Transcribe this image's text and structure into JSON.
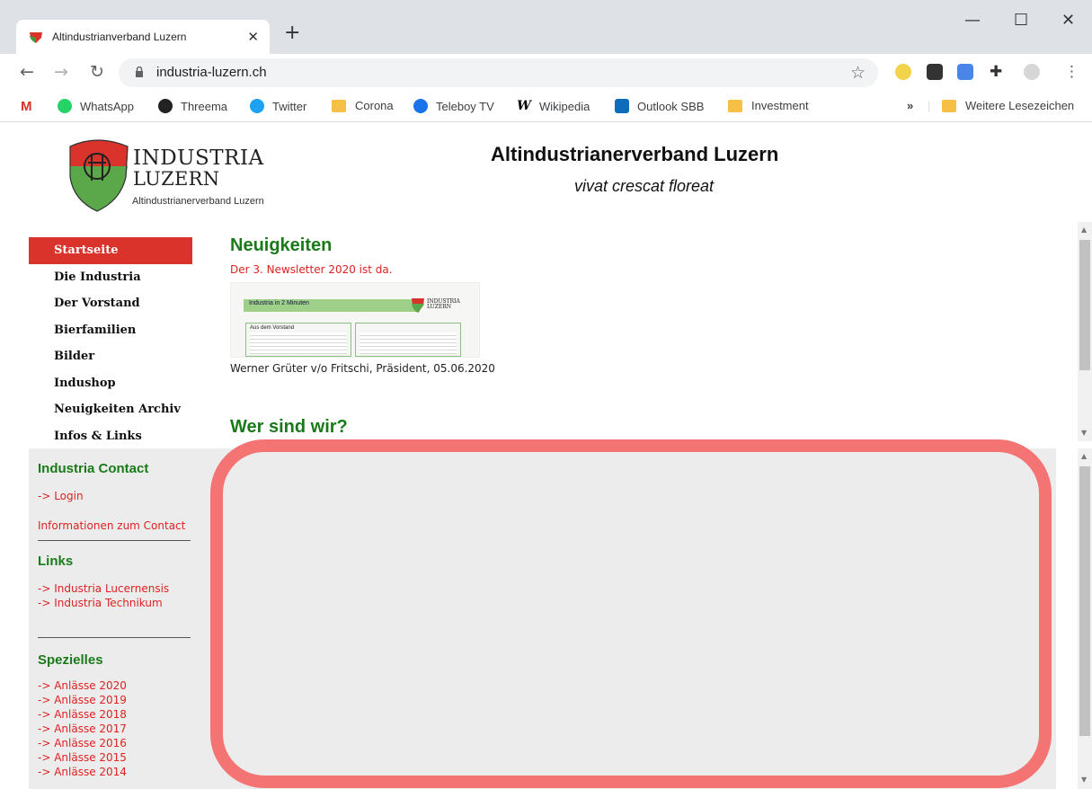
{
  "browser": {
    "tab_title": "Altindustrianverband Luzern",
    "url": "industria-luzern.ch",
    "new_tab_symbol": "+",
    "close_tab_symbol": "✕",
    "window_controls": {
      "minimize": "—",
      "maximize": "☐",
      "close": "✕"
    },
    "more_bookmarks": "»",
    "bookmarks": [
      {
        "label": "WhatsApp",
        "icon": "whatsapp-icon",
        "color": "#25d366"
      },
      {
        "label": "Threema",
        "icon": "threema-icon",
        "color": "#222222"
      },
      {
        "label": "Twitter",
        "icon": "twitter-icon",
        "color": "#1da1f2"
      },
      {
        "label": "Corona",
        "icon": "folder-icon",
        "color": "#f6c046"
      },
      {
        "label": "Teleboy TV",
        "icon": "teleboy-icon",
        "color": "#1a73e8"
      },
      {
        "label": "Wikipedia",
        "icon": "wikipedia-icon",
        "color": "#000000"
      },
      {
        "label": "Outlook SBB",
        "icon": "outlook-icon",
        "color": "#0f6cbd"
      },
      {
        "label": "Investment",
        "icon": "folder-icon",
        "color": "#f6c046"
      }
    ],
    "other_bookmarks": "Weitere Lesezeichen",
    "gmail_icon_letter": "M"
  },
  "site": {
    "logo_line1": "INDUSTRIA",
    "logo_line2": "LUZERN",
    "logo_sub": "Altindustrianerverband Luzern",
    "title": "Altindustrianerverband Luzern",
    "motto": "vivat crescat floreat",
    "colors": {
      "red": "#d9332b",
      "green": "#1a7a1a",
      "link": "#dd2222",
      "highlight": "#f47474"
    }
  },
  "nav": {
    "items": [
      {
        "label": "Startseite",
        "active": true
      },
      {
        "label": "Die Industria"
      },
      {
        "label": "Der Vorstand"
      },
      {
        "label": "Bierfamilien"
      },
      {
        "label": "Bilder"
      },
      {
        "label": "Indushop"
      },
      {
        "label": "Neuigkeiten Archiv"
      },
      {
        "label": "Infos & Links"
      }
    ]
  },
  "main": {
    "heading": "Neuigkeiten",
    "news_link": "Der 3. Newsletter 2020 ist da.",
    "thumbnail": {
      "bar_text": "Industria in 2 Minuten",
      "col_label": "Aus dem Vorstand",
      "logo_text": "INDUSTRIA LUZERN"
    },
    "signature": "Werner Grüter v/o Fritschi, Präsident, 05.06.2020",
    "heading2": "Wer sind wir?"
  },
  "sidebar": {
    "contact_heading": "Industria Contact",
    "login": "-> Login",
    "contact_info": "Informationen zum Contact",
    "links_heading": "Links",
    "links": [
      "-> Industria Lucernensis",
      "-> Industria Technikum"
    ],
    "special_heading": "Spezielles",
    "special": [
      "-> Anlässe 2020",
      "-> Anlässe 2019",
      "-> Anlässe 2018",
      "-> Anlässe 2017",
      "-> Anlässe 2016",
      "-> Anlässe 2015",
      "-> Anlässe 2014"
    ]
  }
}
